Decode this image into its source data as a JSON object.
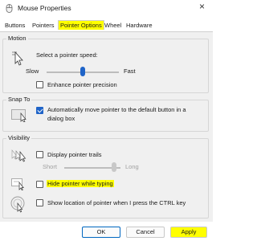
{
  "window": {
    "title": "Mouse Properties"
  },
  "tabs": [
    {
      "label": "Buttons"
    },
    {
      "label": "Pointers"
    },
    {
      "label": "Pointer Options"
    },
    {
      "label": "Wheel"
    },
    {
      "label": "Hardware"
    }
  ],
  "motion": {
    "group_label": "Motion",
    "speed_label": "Select a pointer speed:",
    "slow_label": "Slow",
    "fast_label": "Fast",
    "speed_value": 0.5,
    "precision_label": "Enhance pointer precision",
    "precision_checked": false
  },
  "snap_to": {
    "group_label": "Snap To",
    "snap_label_line1": "Automatically move pointer to the default button in a",
    "snap_label_line2": "dialog box",
    "snap_checked": true
  },
  "visibility": {
    "group_label": "Visibility",
    "trails_label": "Display pointer trails",
    "trails_checked": false,
    "short_label": "Short",
    "long_label": "Long",
    "trails_value": 0.88,
    "hide_label": "Hide pointer while typing",
    "hide_checked": false,
    "ctrl_label": "Show location of pointer when I press the CTRL key",
    "ctrl_checked": false
  },
  "buttons": {
    "ok": "OK",
    "cancel": "Cancel",
    "apply": "Apply"
  },
  "colors": {
    "highlight": "#ffff00",
    "accent": "#1f64c8"
  }
}
